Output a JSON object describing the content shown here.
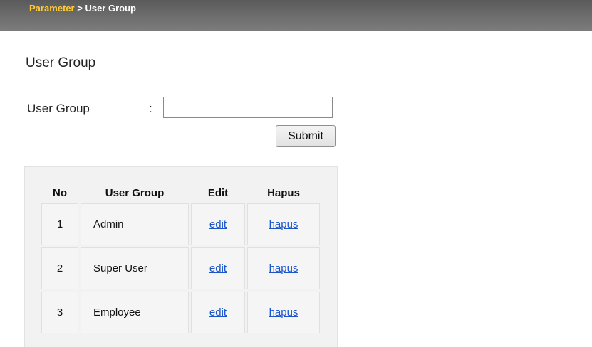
{
  "breadcrumb": {
    "parent": "Parameter",
    "separator": ">",
    "current": "User Group"
  },
  "page": {
    "title": "User Group"
  },
  "form": {
    "label": "User Group",
    "colon": ":",
    "input_value": "",
    "submit_label": "Submit"
  },
  "table": {
    "headers": {
      "no": "No",
      "group": "User Group",
      "edit": "Edit",
      "hapus": "Hapus"
    },
    "rows": [
      {
        "no": "1",
        "group": "Admin",
        "edit": "edit",
        "hapus": "hapus"
      },
      {
        "no": "2",
        "group": "Super User",
        "edit": "edit",
        "hapus": "hapus"
      },
      {
        "no": "3",
        "group": "Employee",
        "edit": "edit",
        "hapus": "hapus"
      }
    ]
  },
  "colors": {
    "breadcrumb_link": "#ffcc33",
    "header_bar": "#6e6e6e",
    "link": "#1a55cc",
    "table_background": "#f2f2f2"
  }
}
